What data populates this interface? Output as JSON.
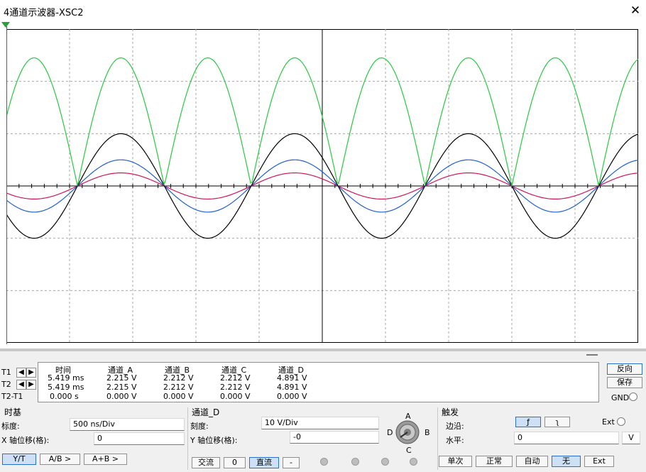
{
  "window": {
    "title": "4通道示波器-XSC2",
    "close_glyph": "✕"
  },
  "cursor_row_labels": [
    "T1",
    "T2",
    "T2-T1"
  ],
  "readout": {
    "headers": [
      "时间",
      "通道_A",
      "通道_B",
      "通道_C",
      "通道_D"
    ],
    "rows": [
      [
        "5.419 ms",
        "2.215 V",
        "2.212 V",
        "2.212 V",
        "4.891 V"
      ],
      [
        "5.419 ms",
        "2.215 V",
        "2.212 V",
        "2.212 V",
        "4.891 V"
      ],
      [
        "0.000 s",
        "0.000 V",
        "0.000 V",
        "0.000 V",
        "0.000 V"
      ]
    ]
  },
  "right_panel": {
    "reverse": "反向",
    "save": "保存",
    "gnd": "GND"
  },
  "timebase": {
    "group": "时基",
    "scale_label": "标度:",
    "scale_value": "500 ns/Div",
    "xpos_label": "X 轴位移(格):",
    "xpos_value": "0",
    "buttons": [
      "Y/T",
      "A/B >",
      "A+B >"
    ]
  },
  "channel": {
    "group": "通道_D",
    "scale_label": "刻度:",
    "scale_value": "10  V/Div",
    "ypos_label": "Y 轴位移(格):",
    "ypos_value": "-0",
    "buttons": [
      "交流",
      "0",
      "直流",
      "-"
    ],
    "knob_labels": {
      "a": "A",
      "b": "B",
      "c": "C",
      "d": "D"
    }
  },
  "trigger": {
    "group": "触发",
    "edge_label": "边沿:",
    "edge_rising": "ƒ",
    "edge_falling": "ʅ",
    "ext": "Ext",
    "level_label": "水平:",
    "level_value": "0",
    "level_unit": "V",
    "modes": [
      "单次",
      "正常",
      "自动",
      "无"
    ],
    "mode_selected": "无",
    "ext_button": "Ext"
  },
  "colors": {
    "channel_a": "#d4145a",
    "channel_b": "#1f5fd1",
    "channel_c": "#000000",
    "channel_d": "#27c93f",
    "grid": "#a8a8a8"
  },
  "chart_data": {
    "type": "line",
    "grid": true,
    "x_divisions": 10,
    "y_divisions": 6,
    "series": [
      {
        "name": "通道_A",
        "color": "#d4145a",
        "kind": "sine",
        "amp_div": 0.25,
        "period_div": 2.75,
        "phase_div": 0.25
      },
      {
        "name": "通道_B",
        "color": "#1f5fd1",
        "kind": "sine",
        "amp_div": 0.5,
        "period_div": 2.75,
        "phase_div": 0.25
      },
      {
        "name": "通道_C",
        "color": "#000000",
        "kind": "sine",
        "amp_div": 1.0,
        "period_div": 2.75,
        "phase_div": 0.25
      },
      {
        "name": "通道_D",
        "color": "#27c93f",
        "kind": "abs_sine",
        "amp_div": 2.45,
        "period_div": 2.75,
        "phase_div": 0.25
      }
    ]
  }
}
